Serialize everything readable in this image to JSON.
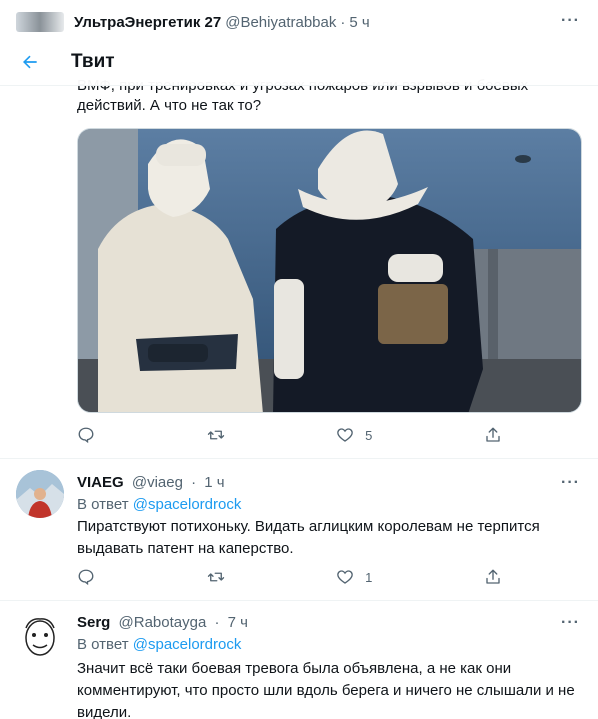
{
  "header": {
    "title": "Твит",
    "back_icon": "arrow-left-icon"
  },
  "top_tweet": {
    "name": "УльтраЭнергетик 27",
    "handle": "@Behiyatrabbak",
    "time": "5 ч"
  },
  "main_tweet": {
    "text_line1": "ВМФ, при тренировках и угрозах пожаров или взрывов и боевых",
    "text_line2": "действий. А что не так то?",
    "likes": "5",
    "accent": "#1d9bf0"
  },
  "replies": [
    {
      "name": "VIAEG",
      "handle": "@viaeg",
      "time": "1 ч",
      "replying_prefix": "В ответ",
      "replying_to": "@spacelordrock",
      "text_lines": [
        "Пиратствуют потихоньку. Видать аглицким королевам не терпится",
        "выдавать патент на каперство."
      ],
      "likes": "1"
    },
    {
      "name": "Serg",
      "handle": "@Rabotayga",
      "time": "7 ч",
      "replying_prefix": "В ответ",
      "replying_to": "@spacelordrock",
      "text_lines": [
        "Значит всё таки боевая тревога была объявлена, а не как они",
        "комментируют, что просто шли вдоль берега и ничего не слышали и не",
        "видели."
      ]
    }
  ],
  "separator": "·",
  "colors": {
    "accent": "#1d9bf0",
    "text": "#0f1419",
    "muted": "#536471"
  }
}
